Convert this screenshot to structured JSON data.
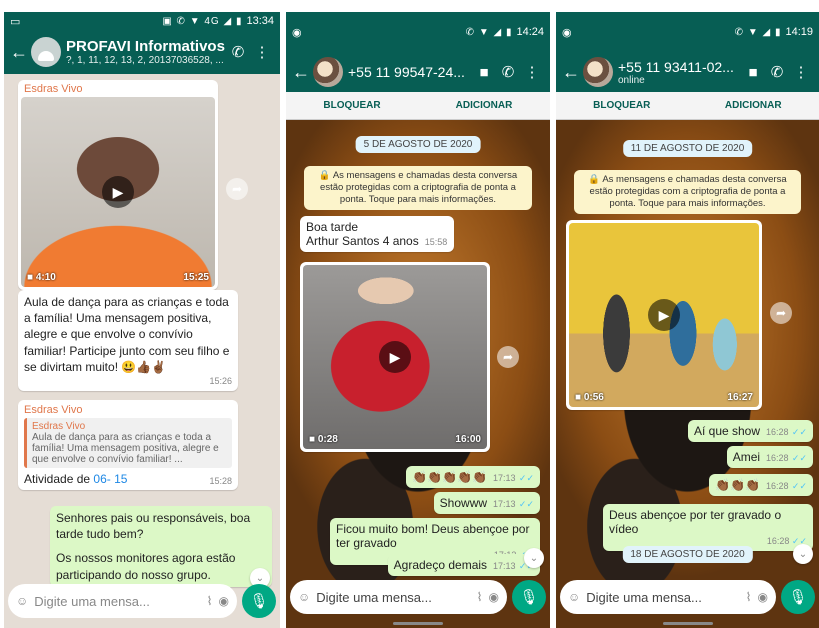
{
  "phone1": {
    "status": {
      "time": "13:34",
      "icons": "▣ ✆ ▼ 4G ◢ ▮"
    },
    "header": {
      "title": "PROFAVI Informativos",
      "subtitle": "?, 1, 11, 12, 13, 2, 20137036528, ..."
    },
    "video_msg": {
      "sender": "Esdras Vivo",
      "duration": "4:10",
      "time": "15:25"
    },
    "text_msg": {
      "text": "Aula de dança para as crianças e toda a família! Uma mensagem positiva, alegre e que envolve o convívio familiar! Participe junto com seu filho e se divirtam muito! 😃👍🏾✌🏾",
      "time": "15:26"
    },
    "reply_msg": {
      "sender": "Esdras Vivo",
      "quote_name": "Esdras Vivo",
      "quote_text": "Aula de dança para as crianças e toda a família! Uma mensagem positiva, alegre e que envolve o convívio familiar! ...",
      "text_prefix": "Atividade de ",
      "text_link": "06- 15",
      "time": "15:28"
    },
    "out_msg": {
      "line1": "Senhores pais ou responsáveis, boa tarde tudo bem?",
      "line2": "Os nossos monitores agora estão participando do nosso grupo."
    },
    "input_placeholder": "Digite uma mensa..."
  },
  "phone2": {
    "status": {
      "time": "14:24",
      "icons": "✆ ▼ ◢ ▮"
    },
    "header": {
      "title": "+55 11 99547-24..."
    },
    "actions": {
      "block": "BLOQUEAR",
      "add": "ADICIONAR"
    },
    "date": "5 DE AGOSTO DE 2020",
    "notice": "🔒 As mensagens e chamadas desta conversa estão protegidas com a criptografia de ponta a ponta. Toque para mais informações.",
    "in_msg": {
      "line1": "Boa tarde",
      "line2": "Arthur Santos 4 anos",
      "time": "15:58"
    },
    "video": {
      "duration": "0:28",
      "time": "16:00"
    },
    "out_msgs": [
      {
        "text": "👏🏾👏🏾👏🏾👏🏾👏🏾",
        "time": "17:13"
      },
      {
        "text": "Showww",
        "time": "17:13"
      },
      {
        "text": "Ficou muito bom! Deus abençoe por ter gravado",
        "time": "17:13"
      },
      {
        "text": "Agradeço demais",
        "time": "17:13"
      }
    ],
    "input_placeholder": "Digite uma mensa..."
  },
  "phone3": {
    "status": {
      "time": "14:19",
      "icons": "✆ ▼ ◢ ▮"
    },
    "header": {
      "title": "+55 11 93411-02...",
      "subtitle": "online"
    },
    "actions": {
      "block": "BLOQUEAR",
      "add": "ADICIONAR"
    },
    "date": "11 DE AGOSTO DE 2020",
    "notice": "🔒 As mensagens e chamadas desta conversa estão protegidas com a criptografia de ponta a ponta. Toque para mais informações.",
    "video": {
      "duration": "0:56",
      "time": "16:27"
    },
    "out_msgs": [
      {
        "text": "Aí que show",
        "time": "16:28"
      },
      {
        "text": "Amei",
        "time": "16:28"
      },
      {
        "text": "👏🏾👏🏾👏🏾",
        "time": "16:28"
      },
      {
        "text": "Deus abençoe por ter gravado o vídeo",
        "time": "16:28"
      }
    ],
    "date2": "18 DE AGOSTO DE 2020",
    "input_placeholder": "Digite uma mensa..."
  },
  "icons": {
    "back": "arrow-back",
    "call": "phone",
    "video": "videocam",
    "menu": "more-vert",
    "emoji": "emoji",
    "attach": "paperclip",
    "camera": "camera",
    "mic": "microphone",
    "forward": "share"
  },
  "colors": {
    "header": "#075e54",
    "outgoing": "#dcf8c6",
    "mic": "#00a884",
    "sender": "#e0774b"
  }
}
